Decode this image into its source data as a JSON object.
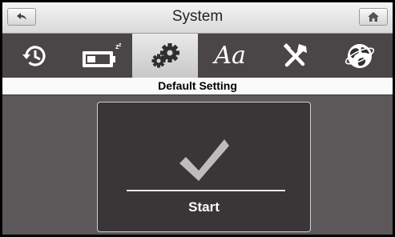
{
  "window": {
    "title": "System"
  },
  "toolbar": {
    "back": {
      "icon": "back-arrow-icon"
    },
    "home": {
      "icon": "home-icon"
    }
  },
  "tabs": [
    {
      "icon": "history-clock-icon"
    },
    {
      "icon": "battery-sleep-icon"
    },
    {
      "icon": "gears-icon",
      "active": true
    },
    {
      "icon": "font-icon",
      "label": "Aa"
    },
    {
      "icon": "tools-icon"
    },
    {
      "icon": "globe-icon"
    }
  ],
  "section": {
    "title": "Default Setting"
  },
  "panel": {
    "icon": "checkmark-icon",
    "start_label": "Start"
  }
}
